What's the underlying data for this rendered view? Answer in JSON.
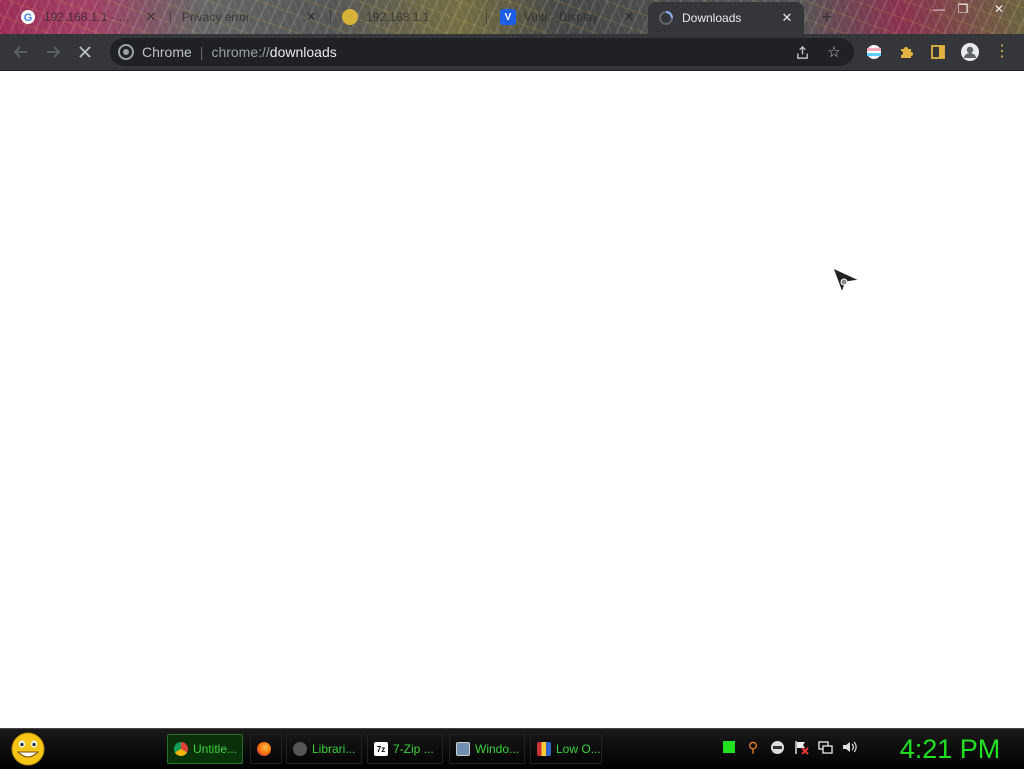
{
  "tabs": [
    {
      "title": "192.168.1.1 - Goo",
      "favicon": "google-g-icon"
    },
    {
      "title": "Privacy error",
      "favicon": "warning-icon"
    },
    {
      "title": "192.168.1.1",
      "favicon": "site-icon"
    },
    {
      "title": "Vultr - Display",
      "favicon": "vultr-icon"
    },
    {
      "title": "Downloads",
      "favicon": "downloads-loading-icon",
      "active": true
    }
  ],
  "toolbar": {
    "chip_label": "Chrome",
    "url_scheme": "chrome://",
    "url_host": "downloads"
  },
  "taskbar": {
    "items": [
      {
        "label": "Untitle...",
        "icon": "chrome-icon",
        "active": true
      },
      {
        "label": "",
        "icon": "firefox-icon"
      },
      {
        "label": "Librari...",
        "icon": "library-icon"
      },
      {
        "label": "7-Zip ...",
        "icon": "7zip-icon"
      },
      {
        "label": "Windo...",
        "icon": "window-icon"
      },
      {
        "label": "Low O...",
        "icon": "app-icon"
      }
    ],
    "clock": "4:21 PM"
  },
  "colors": {
    "toolbar_bg": "#35363a",
    "omnibox_bg": "#202124",
    "taskbar_text": "#3ad13a",
    "clock": "#20e020"
  }
}
